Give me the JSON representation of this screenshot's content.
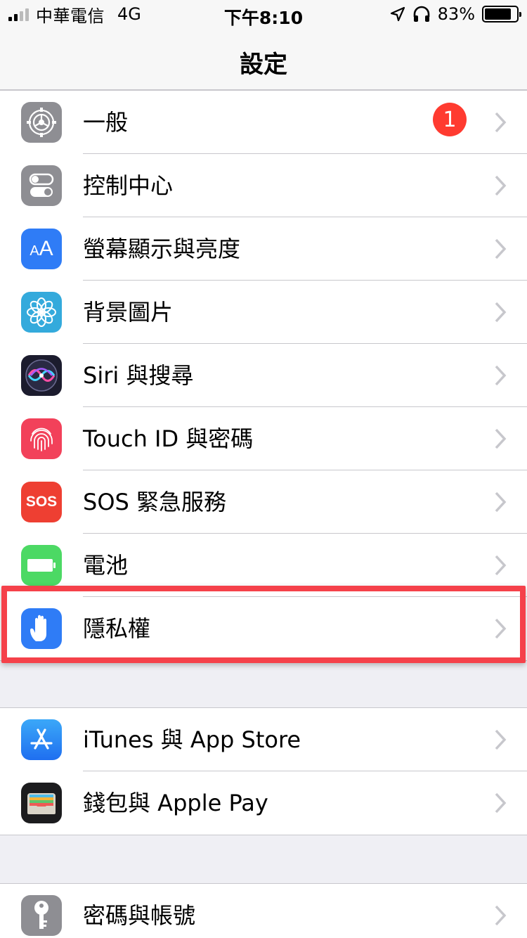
{
  "status_bar": {
    "carrier": "中華電信",
    "network": "4G",
    "time": "下午8:10",
    "battery_percent": "83%",
    "battery_level": 0.83,
    "icons": [
      "signal-icon",
      "location-arrow-icon",
      "headphones-icon",
      "battery-icon"
    ]
  },
  "nav": {
    "title": "設定"
  },
  "group1": {
    "items": [
      {
        "label": "一般",
        "icon": "gear-icon",
        "color": "#8e8e93",
        "badge": "1"
      },
      {
        "label": "控制中心",
        "icon": "toggles-icon",
        "color": "#8e8e93"
      },
      {
        "label": "螢幕顯示與亮度",
        "icon": "text-size-icon",
        "color": "#2f7cf6",
        "icon_text": "AA"
      },
      {
        "label": "背景圖片",
        "icon": "flower-icon",
        "color": "#34aadc"
      },
      {
        "label": "Siri 與搜尋",
        "icon": "siri-icon",
        "color": "#1c1c2e"
      },
      {
        "label": "Touch ID 與密碼",
        "icon": "fingerprint-icon",
        "color": "#f2415a"
      },
      {
        "label": "SOS 緊急服務",
        "icon": "sos-icon",
        "color": "#ee3f32",
        "icon_text": "SOS"
      },
      {
        "label": "電池",
        "icon": "battery-icon",
        "color": "#4cd964"
      },
      {
        "label": "隱私權",
        "icon": "hand-icon",
        "color": "#2f7cf6"
      }
    ]
  },
  "group2": {
    "items": [
      {
        "label": "iTunes 與 App Store",
        "icon": "app-store-icon",
        "color": "#2f8cf6"
      },
      {
        "label": "錢包與 Apple Pay",
        "icon": "wallet-icon",
        "color": "#1c1c1e"
      }
    ]
  },
  "group3": {
    "items": [
      {
        "label": "密碼與帳號",
        "icon": "key-icon",
        "color": "#8e8e93"
      }
    ]
  },
  "highlight_color": "#f5414a"
}
